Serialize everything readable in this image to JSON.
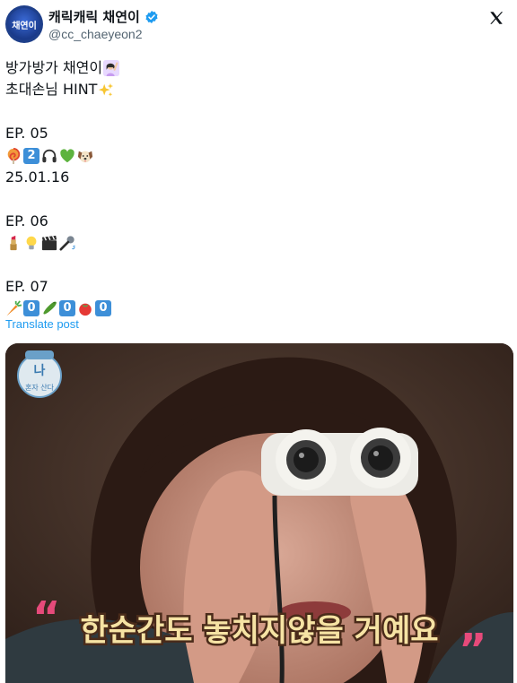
{
  "account": {
    "display_name": "캐릭캐릭 채연이",
    "handle": "@cc_chaeyeon2",
    "avatar_text": "채연이"
  },
  "post": {
    "lines": [
      "방가방가 채연이",
      "초대손님 HINT",
      "",
      "EP. 05",
      "",
      "25.01.16",
      "",
      "EP. 06",
      "",
      "",
      "EP. 07"
    ],
    "ep05_emojis": [
      "lollipop-icon",
      "keycap-2-icon",
      "headphones-icon",
      "green-heart-icon",
      "dog-face-icon"
    ],
    "ep05_keycap": "2",
    "ep06_emojis": [
      "lipstick-icon",
      "light-bulb-icon",
      "clapper-board-icon",
      "microphone-icon"
    ],
    "ep07_emojis": [
      "carrot-icon",
      "keycap-0-icon",
      "cucumber-icon",
      "keycap-0-icon",
      "tomato-icon",
      "keycap-0-icon"
    ],
    "ep07_keycap": "0",
    "translate_label": "Translate post"
  },
  "media": {
    "caption": "한순간도 놓치지않을 거예요",
    "logo_text": "나",
    "logo_subtext": "혼자 산다"
  },
  "colors": {
    "link": "#1d9bf0",
    "verified": "#1d9bf0",
    "handle_gray": "#536471",
    "keycap_blue": "#3d8fd8"
  }
}
